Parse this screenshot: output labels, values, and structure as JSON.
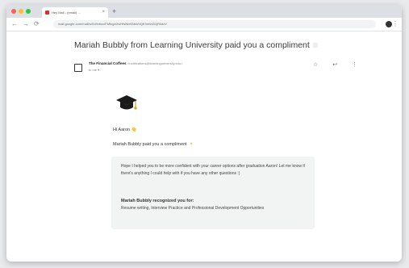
{
  "browser": {
    "tab_title": "Hey Mail - (email) ...",
    "new_tab": "+",
    "close_tab": "×",
    "url": "mail.google.com/mail/u/0/#inbox/FMfcgzGwHfsNbKBbWxQKhmWZDjRkdxV",
    "nav": {
      "back": "←",
      "forward": "→",
      "reload": "⟳"
    },
    "menu": "⋮"
  },
  "email": {
    "subject": "Mariah Bubbly from Learning University paid you a compliment",
    "sender_name": "The Financial Coffees",
    "sender_email": "<notifications@learninguniversity.edu>",
    "to": "to me ▾",
    "actions": "☆ ↩ ⋮"
  },
  "body": {
    "greeting": "Hi Aaron 👋",
    "intro": "Mariah Bubbly paid you a compliment",
    "spark": "✦",
    "message": "Hope I helped you to be more confident with your career options after graduation Aaron! Let me know if there's anything I could help with if you have any other questions :)",
    "recognized_title": "Mariah Bubbly recognized you for:",
    "skills": "Resume writing, Interview Practice and Professional Development Opportunities"
  }
}
